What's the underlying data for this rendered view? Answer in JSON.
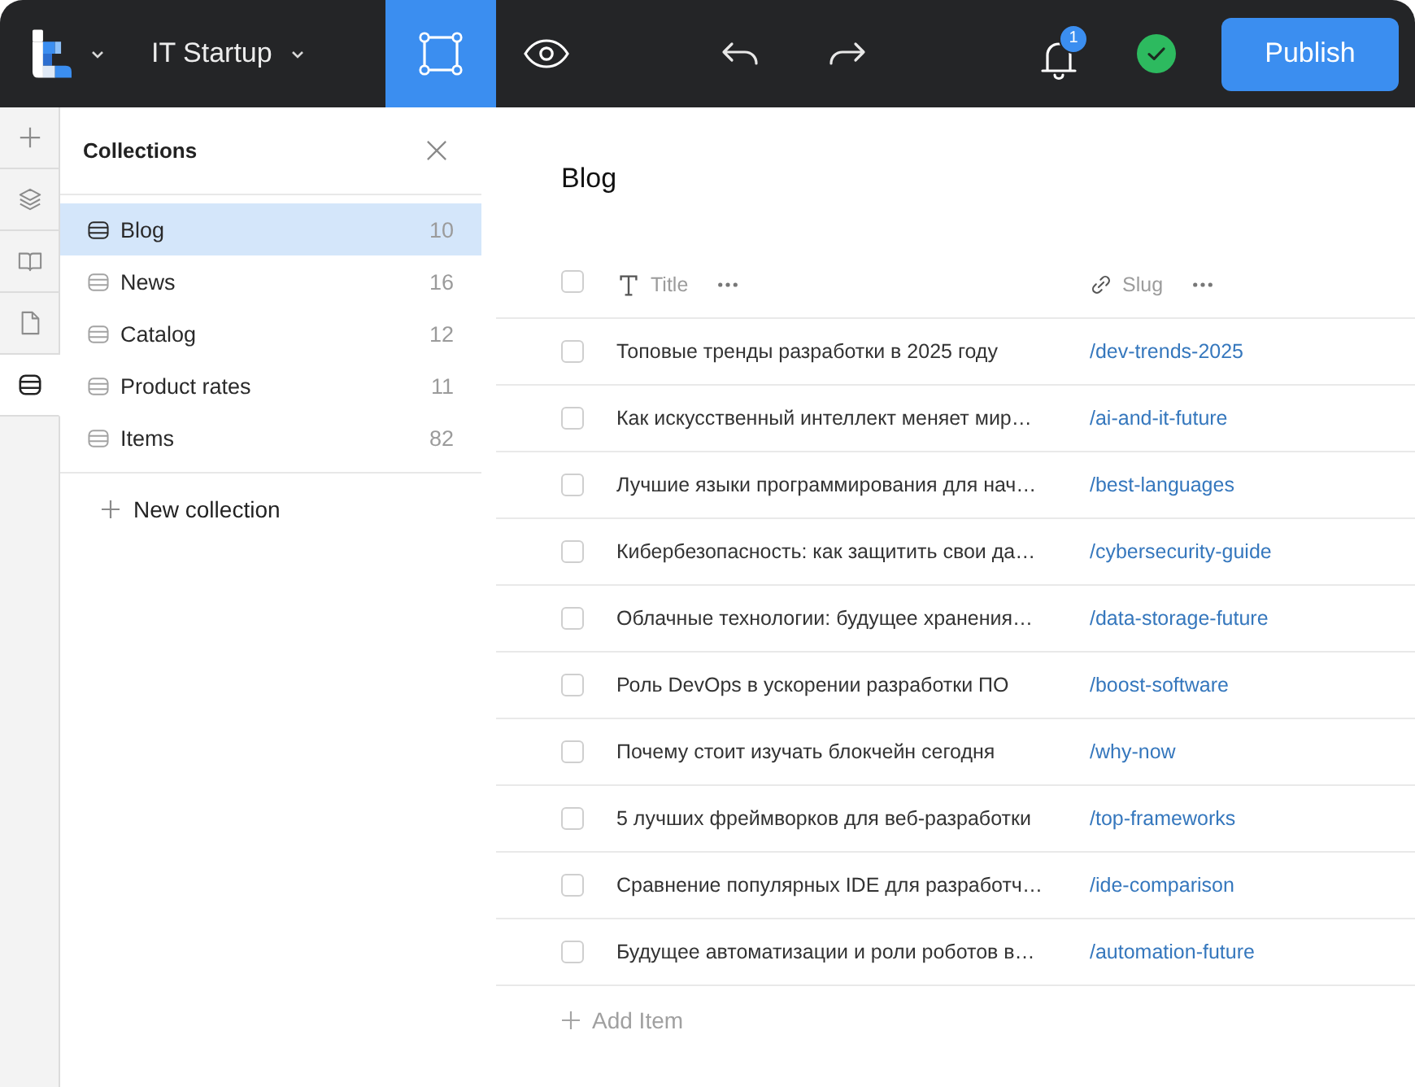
{
  "topbar": {
    "project": "IT Startup",
    "modes": [
      {
        "kind": "design",
        "selected": true
      },
      {
        "kind": "preview",
        "selected": false
      }
    ],
    "notifications": {
      "badge": "1"
    },
    "saved": true,
    "publish": "Publish"
  },
  "rail": [
    {
      "kind": "add",
      "selected": false
    },
    {
      "kind": "layers",
      "selected": false
    },
    {
      "kind": "book",
      "selected": false
    },
    {
      "kind": "file",
      "selected": false
    },
    {
      "kind": "database",
      "selected": true
    }
  ],
  "collections": {
    "title": "Collections",
    "items": [
      {
        "name": "Blog",
        "count": "10",
        "selected": true
      },
      {
        "name": "News",
        "count": "16",
        "selected": false
      },
      {
        "name": "Catalog",
        "count": "12",
        "selected": false
      },
      {
        "name": "Product rates",
        "count": "11",
        "selected": false
      },
      {
        "name": "Items",
        "count": "82",
        "selected": false
      }
    ],
    "new_button": "New collection"
  },
  "table": {
    "title": "Blog",
    "select_all": {
      "checked": false
    },
    "columns": [
      {
        "kind": "text",
        "label": "Title"
      },
      {
        "kind": "link",
        "label": "Slug"
      }
    ],
    "rows": [
      {
        "checked": false,
        "title": "Топовые тренды разработки в 2025 году",
        "slug": "/dev-trends-2025"
      },
      {
        "checked": false,
        "title": "Как искусственный интеллект меняет мир…",
        "slug": "/ai-and-it-future"
      },
      {
        "checked": false,
        "title": "Лучшие языки программирования для нач…",
        "slug": "/best-languages"
      },
      {
        "checked": false,
        "title": "Кибербезопасность: как защитить свои да…",
        "slug": "/cybersecurity-guide"
      },
      {
        "checked": false,
        "title": "Облачные технологии: будущее хранения…",
        "slug": "/data-storage-future"
      },
      {
        "checked": false,
        "title": "Роль DevOps в ускорении разработки ПО",
        "slug": "/boost-software"
      },
      {
        "checked": false,
        "title": "Почему стоит изучать блокчейн сегодня",
        "slug": "/why-now"
      },
      {
        "checked": false,
        "title": "5 лучших фреймворков для веб-разработки",
        "slug": "/top-frameworks"
      },
      {
        "checked": false,
        "title": "Сравнение популярных IDE для разработч…",
        "slug": "/ide-comparison"
      },
      {
        "checked": false,
        "title": "Будущее автоматизации и роли роботов в…",
        "slug": "/automation-future"
      }
    ],
    "add_button": "Add Item"
  }
}
